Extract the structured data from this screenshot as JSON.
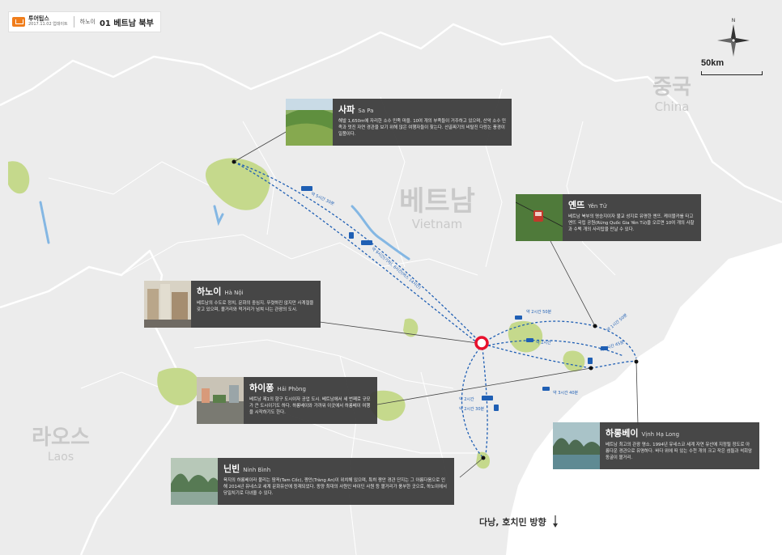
{
  "header": {
    "brand": "투어팁스",
    "date": "2017.11.02 업데이트",
    "city": "하노이",
    "title": "01 베트남 북부"
  },
  "scale": {
    "label": "50km"
  },
  "compass": {
    "north": "N"
  },
  "countries": {
    "china": {
      "ko": "중국",
      "en": "China"
    },
    "vietnam": {
      "ko": "베트남",
      "en": "Vietnam"
    },
    "laos": {
      "ko": "라오스",
      "en": "Laos"
    }
  },
  "places": {
    "sapa": {
      "ko": "사파",
      "en": "Sa Pa",
      "desc": "해발 1,650m에 자리한 소수 민족 마을. 10여 개의 부족들이 거주하고 있으며, 산악 소수 민족과 멋진 자연 경관을 보기 위해 많은 여행자들이 찾는다. 산골짜기의 비탈진 다랑논 풍경이 일품이다."
    },
    "yentu": {
      "ko": "옌뜨",
      "en": "Yên Tử",
      "desc": "베트남 북부의 명승지이자 불교 성지로 유명한 옌뜨. 케이블카를 타고 옌뜨 국립 공원(Rừng Quốc Gia Yên Tử)을 오르면 10여 개의 사찰과 수백 개의 사리탑을 만날 수 있다."
    },
    "hanoi": {
      "ko": "하노이",
      "en": "Hà Nội",
      "desc": "베트남의 수도로 정치, 문화의 중심지. 뚜렷하진 않지만 사계절을 갖고 있으며, 볼거리와 먹거리가 넘쳐 나는 관광의 도시."
    },
    "haiphong": {
      "ko": "하이퐁",
      "en": "Hải Phòng",
      "desc": "베트남 제1의 항구 도시이자 공업 도시. 베트남에서 세 번째로 규모가 큰 도시이기도 하다. 하롱베이와 가까워 이곳에서 하롱베이 여행을 시작하기도 한다."
    },
    "halong": {
      "ko": "하롱베이",
      "en": "Vịnh Hạ Long",
      "desc": "베트남 최고의 관광 명소. 1994년 유네스코 세계 자연 유산에 지정될 정도로 아름다운 경관으로 유명하다. 바다 위에 떠 있는 수천 개의 크고 작은 섬들과 석회암 동굴이 볼거리."
    },
    "ninhbinh": {
      "ko": "닌빈",
      "en": "Ninh Bình",
      "desc": "육지의 하롱베이라 불리는 땀꼭(Tam Cốc), 짱안(Tràng An)이 위치해 있으며, 특히 짱안 경관 단지는 그 아름다움으로 인해 2014년 유네스코 세계 문화유산에 등재되었다. 동양 최대의 사원인 바이딘 사원 등 볼거리가 풍부한 곳으로, 하노이에서 당일치기로 다녀올 수 있다."
    }
  },
  "routes": {
    "sapa_train": "약 5시간 30분",
    "sapa_bus": "약 9시간(기차), 6시간(버스 14시간)",
    "yentu_time": "약 2시간 50분",
    "halong_yentu": "약 1시간 50분",
    "halong_time": "약 2시간",
    "haiphong_time": "약 1시간 45분",
    "haiphong_halong": "약 3시간 40분",
    "ninhbinh_train": "약 2시간",
    "ninhbinh_bus": "약 2시간 30분"
  },
  "destination": {
    "label": "다낭, 호치민 방향"
  },
  "colors": {
    "land": "#ececec",
    "sea": "#ffffff",
    "green": "#c5d98c",
    "water": "#84b7e3",
    "route": "#1f5fb4",
    "hanoi_marker": "#e8112d",
    "callout_bg": "#373737",
    "brand_orange": "#f07d1b"
  }
}
